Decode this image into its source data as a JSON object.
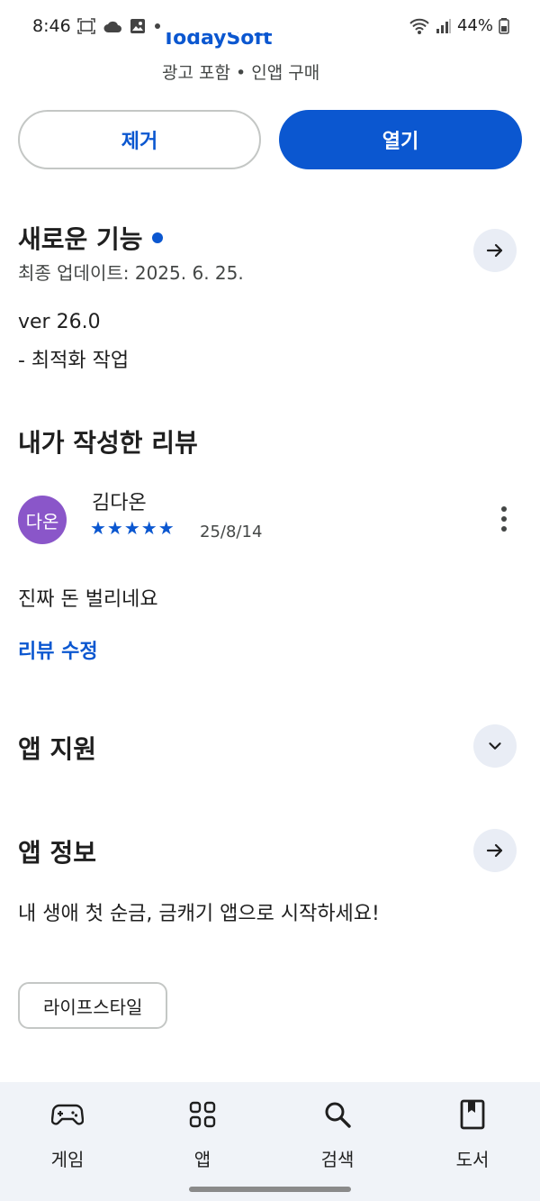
{
  "status_bar": {
    "time": "8:46",
    "battery": "44%"
  },
  "app_header": {
    "developer": "TodaySoft",
    "meta": "광고 포함 • 인앱 구매"
  },
  "actions": {
    "remove_label": "제거",
    "open_label": "열기"
  },
  "whats_new": {
    "title": "새로운 기능",
    "updated": "최종 업데이트: 2025. 6. 25.",
    "version": "ver 26.0",
    "notes": "- 최적화 작업"
  },
  "my_review": {
    "title": "내가 작성한 리뷰",
    "avatar_text": "다온",
    "reviewer": "김다온",
    "stars": "★★★★★",
    "rating": 5,
    "date": "25/8/14",
    "text": "진짜 돈 벌리네요",
    "edit_label": "리뷰 수정"
  },
  "app_support": {
    "title": "앱 지원"
  },
  "app_info": {
    "title": "앱 정보",
    "description": "내 생애 첫 순금, 금캐기 앱으로 시작하세요!",
    "category": "라이프스타일"
  },
  "bottom_nav": {
    "items": [
      {
        "label": "게임",
        "icon": "gamepad-icon"
      },
      {
        "label": "앱",
        "icon": "apps-grid-icon"
      },
      {
        "label": "검색",
        "icon": "search-icon"
      },
      {
        "label": "도서",
        "icon": "book-icon"
      }
    ]
  },
  "colors": {
    "accent": "#0b57d0",
    "avatar": "#8a56c9",
    "nav_bg": "#f0f3f8"
  }
}
